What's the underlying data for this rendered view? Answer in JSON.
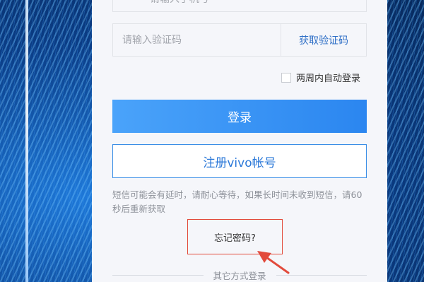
{
  "phone": {
    "hint": "请输入手机号"
  },
  "code": {
    "placeholder": "请输入验证码",
    "get_code_label": "获取验证码"
  },
  "remember": {
    "label": "两周内自动登录"
  },
  "buttons": {
    "login": "登录",
    "register": "注册vivo帐号"
  },
  "sms_note": "短信可能会有延时，请耐心等待，如果长时间未收到短信，请60秒后重新获取",
  "forgot": {
    "label": "忘记密码?"
  },
  "other_login": {
    "label": "其它方式登录"
  },
  "colors": {
    "annotation": "#e24a3b",
    "brand": "#2b86f0"
  },
  "icons": {
    "annotation_arrow": "red-arrow-icon",
    "checkbox": "checkbox-icon"
  }
}
